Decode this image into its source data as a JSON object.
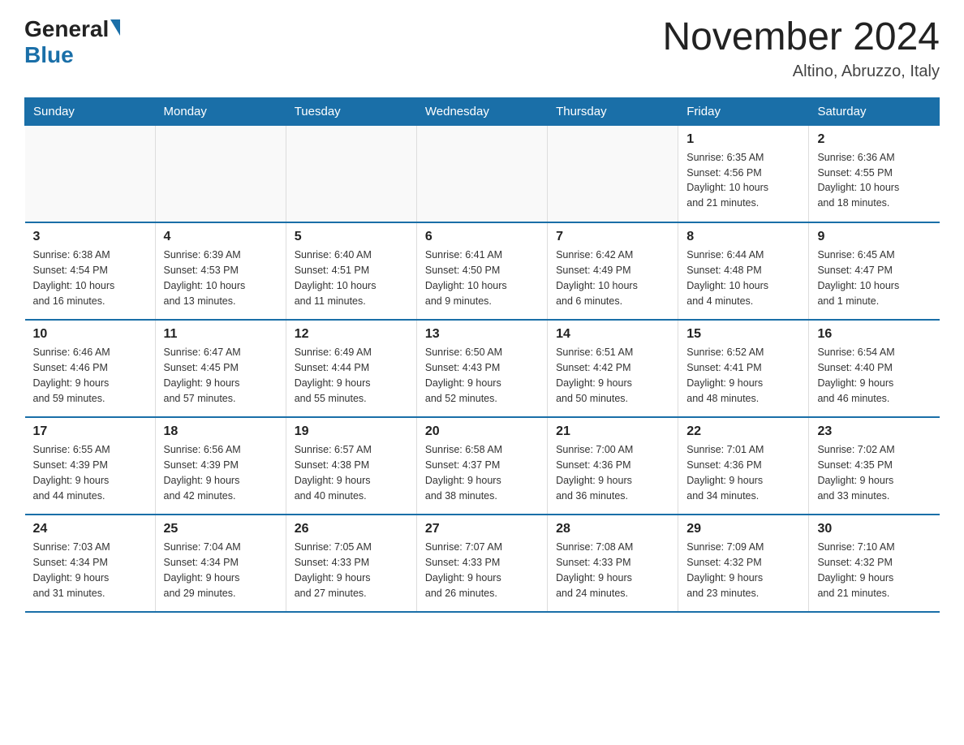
{
  "header": {
    "logo_general": "General",
    "logo_blue": "Blue",
    "title": "November 2024",
    "location": "Altino, Abruzzo, Italy"
  },
  "days_of_week": [
    "Sunday",
    "Monday",
    "Tuesday",
    "Wednesday",
    "Thursday",
    "Friday",
    "Saturday"
  ],
  "weeks": [
    [
      {
        "day": "",
        "info": ""
      },
      {
        "day": "",
        "info": ""
      },
      {
        "day": "",
        "info": ""
      },
      {
        "day": "",
        "info": ""
      },
      {
        "day": "",
        "info": ""
      },
      {
        "day": "1",
        "info": "Sunrise: 6:35 AM\nSunset: 4:56 PM\nDaylight: 10 hours\nand 21 minutes."
      },
      {
        "day": "2",
        "info": "Sunrise: 6:36 AM\nSunset: 4:55 PM\nDaylight: 10 hours\nand 18 minutes."
      }
    ],
    [
      {
        "day": "3",
        "info": "Sunrise: 6:38 AM\nSunset: 4:54 PM\nDaylight: 10 hours\nand 16 minutes."
      },
      {
        "day": "4",
        "info": "Sunrise: 6:39 AM\nSunset: 4:53 PM\nDaylight: 10 hours\nand 13 minutes."
      },
      {
        "day": "5",
        "info": "Sunrise: 6:40 AM\nSunset: 4:51 PM\nDaylight: 10 hours\nand 11 minutes."
      },
      {
        "day": "6",
        "info": "Sunrise: 6:41 AM\nSunset: 4:50 PM\nDaylight: 10 hours\nand 9 minutes."
      },
      {
        "day": "7",
        "info": "Sunrise: 6:42 AM\nSunset: 4:49 PM\nDaylight: 10 hours\nand 6 minutes."
      },
      {
        "day": "8",
        "info": "Sunrise: 6:44 AM\nSunset: 4:48 PM\nDaylight: 10 hours\nand 4 minutes."
      },
      {
        "day": "9",
        "info": "Sunrise: 6:45 AM\nSunset: 4:47 PM\nDaylight: 10 hours\nand 1 minute."
      }
    ],
    [
      {
        "day": "10",
        "info": "Sunrise: 6:46 AM\nSunset: 4:46 PM\nDaylight: 9 hours\nand 59 minutes."
      },
      {
        "day": "11",
        "info": "Sunrise: 6:47 AM\nSunset: 4:45 PM\nDaylight: 9 hours\nand 57 minutes."
      },
      {
        "day": "12",
        "info": "Sunrise: 6:49 AM\nSunset: 4:44 PM\nDaylight: 9 hours\nand 55 minutes."
      },
      {
        "day": "13",
        "info": "Sunrise: 6:50 AM\nSunset: 4:43 PM\nDaylight: 9 hours\nand 52 minutes."
      },
      {
        "day": "14",
        "info": "Sunrise: 6:51 AM\nSunset: 4:42 PM\nDaylight: 9 hours\nand 50 minutes."
      },
      {
        "day": "15",
        "info": "Sunrise: 6:52 AM\nSunset: 4:41 PM\nDaylight: 9 hours\nand 48 minutes."
      },
      {
        "day": "16",
        "info": "Sunrise: 6:54 AM\nSunset: 4:40 PM\nDaylight: 9 hours\nand 46 minutes."
      }
    ],
    [
      {
        "day": "17",
        "info": "Sunrise: 6:55 AM\nSunset: 4:39 PM\nDaylight: 9 hours\nand 44 minutes."
      },
      {
        "day": "18",
        "info": "Sunrise: 6:56 AM\nSunset: 4:39 PM\nDaylight: 9 hours\nand 42 minutes."
      },
      {
        "day": "19",
        "info": "Sunrise: 6:57 AM\nSunset: 4:38 PM\nDaylight: 9 hours\nand 40 minutes."
      },
      {
        "day": "20",
        "info": "Sunrise: 6:58 AM\nSunset: 4:37 PM\nDaylight: 9 hours\nand 38 minutes."
      },
      {
        "day": "21",
        "info": "Sunrise: 7:00 AM\nSunset: 4:36 PM\nDaylight: 9 hours\nand 36 minutes."
      },
      {
        "day": "22",
        "info": "Sunrise: 7:01 AM\nSunset: 4:36 PM\nDaylight: 9 hours\nand 34 minutes."
      },
      {
        "day": "23",
        "info": "Sunrise: 7:02 AM\nSunset: 4:35 PM\nDaylight: 9 hours\nand 33 minutes."
      }
    ],
    [
      {
        "day": "24",
        "info": "Sunrise: 7:03 AM\nSunset: 4:34 PM\nDaylight: 9 hours\nand 31 minutes."
      },
      {
        "day": "25",
        "info": "Sunrise: 7:04 AM\nSunset: 4:34 PM\nDaylight: 9 hours\nand 29 minutes."
      },
      {
        "day": "26",
        "info": "Sunrise: 7:05 AM\nSunset: 4:33 PM\nDaylight: 9 hours\nand 27 minutes."
      },
      {
        "day": "27",
        "info": "Sunrise: 7:07 AM\nSunset: 4:33 PM\nDaylight: 9 hours\nand 26 minutes."
      },
      {
        "day": "28",
        "info": "Sunrise: 7:08 AM\nSunset: 4:33 PM\nDaylight: 9 hours\nand 24 minutes."
      },
      {
        "day": "29",
        "info": "Sunrise: 7:09 AM\nSunset: 4:32 PM\nDaylight: 9 hours\nand 23 minutes."
      },
      {
        "day": "30",
        "info": "Sunrise: 7:10 AM\nSunset: 4:32 PM\nDaylight: 9 hours\nand 21 minutes."
      }
    ]
  ]
}
